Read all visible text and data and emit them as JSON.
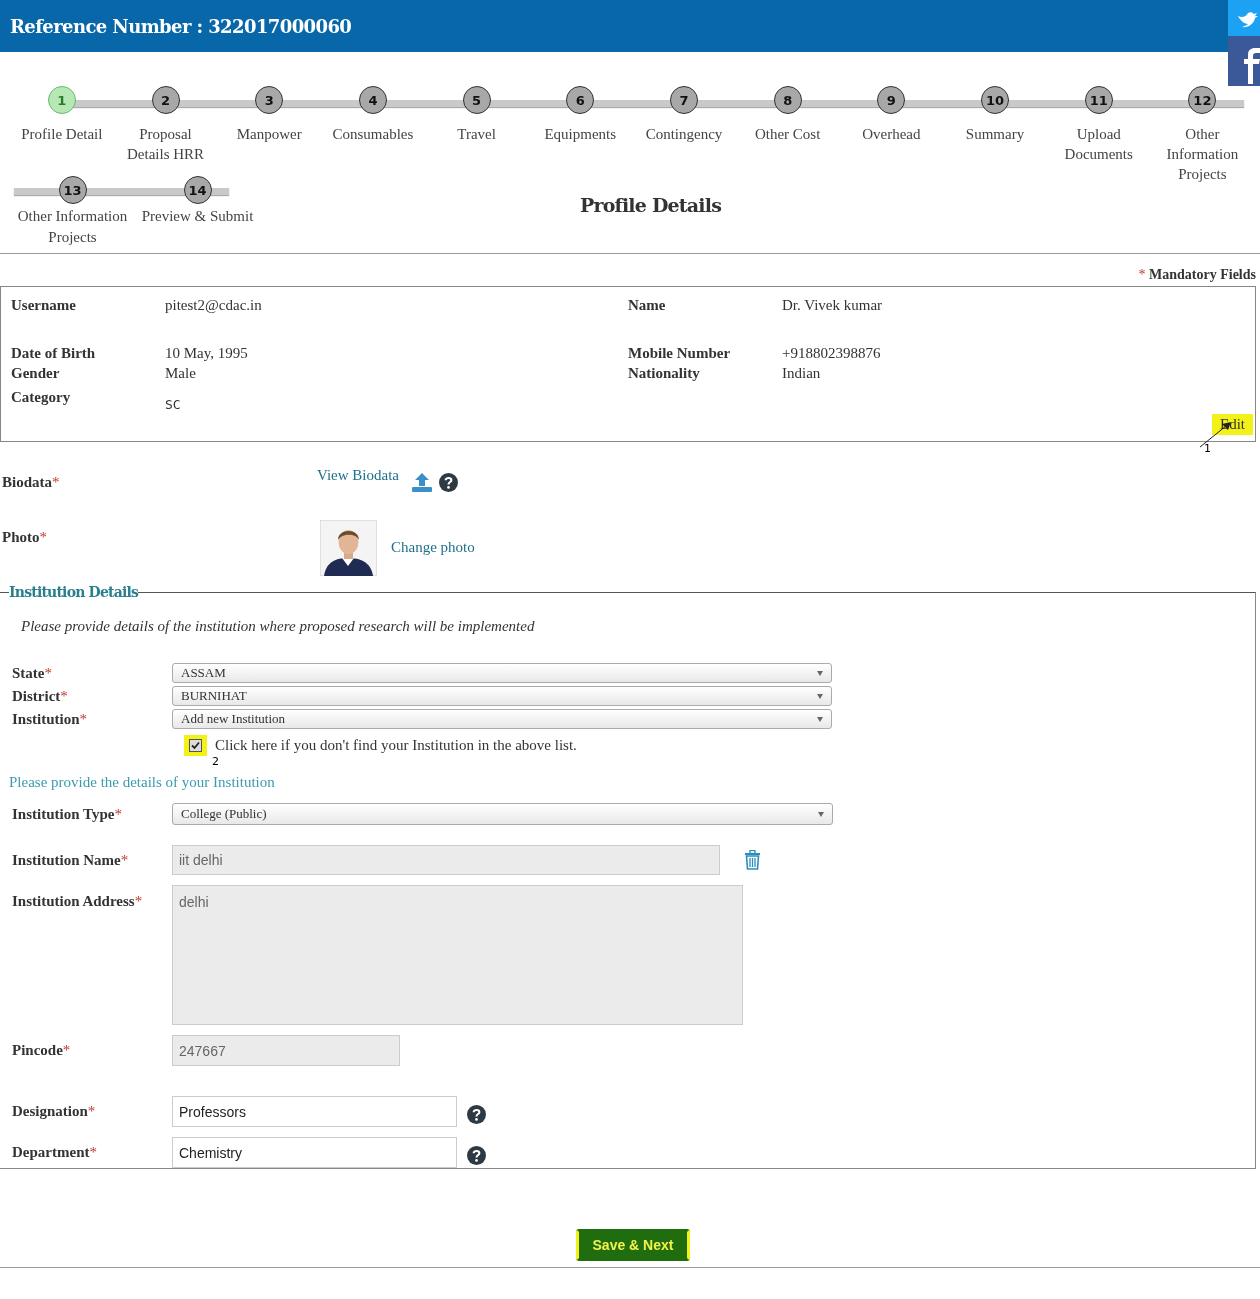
{
  "header": {
    "title": "Reference Number : 322017000060"
  },
  "steps": [
    {
      "number": "1",
      "label": "Profile Detail",
      "selected": true
    },
    {
      "number": "2",
      "label": "Proposal Details HRR",
      "selected": false
    },
    {
      "number": "3",
      "label": "Manpower",
      "selected": false
    },
    {
      "number": "4",
      "label": "Consumables",
      "selected": false
    },
    {
      "number": "5",
      "label": "Travel",
      "selected": false
    },
    {
      "number": "6",
      "label": "Equipments",
      "selected": false
    },
    {
      "number": "7",
      "label": "Contingency",
      "selected": false
    },
    {
      "number": "8",
      "label": "Other Cost",
      "selected": false
    },
    {
      "number": "9",
      "label": "Overhead",
      "selected": false
    },
    {
      "number": "10",
      "label": "Summary",
      "selected": false
    },
    {
      "number": "11",
      "label": "Upload Documents",
      "selected": false
    },
    {
      "number": "12",
      "label": "Other Information Projects",
      "selected": false
    },
    {
      "number": "13",
      "label": "Other  Information Projects",
      "selected": false
    },
    {
      "number": "14",
      "label": "Preview & Submit",
      "selected": false
    }
  ],
  "page_title": "Profile Details",
  "mandatory_note": {
    "mark": "*",
    "text": "Mandatory Fields"
  },
  "profile": {
    "fields": [
      {
        "label": "Username",
        "value": "pitest2@cdac.in"
      },
      {
        "label": "Name",
        "value": "Dr. Vivek  kumar"
      },
      {
        "label": "Date of Birth",
        "value": "10 May, 1995"
      },
      {
        "label": "Mobile Number",
        "value": "+918802398876"
      },
      {
        "label": "Gender",
        "value": "Male"
      },
      {
        "label": "Nationality",
        "value": "Indian"
      },
      {
        "label": "Category",
        "value": "SC"
      }
    ],
    "edit": {
      "label": "Edit",
      "annotation": "1"
    }
  },
  "biodata": {
    "label": "Biodata",
    "link": "View Biodata"
  },
  "photo": {
    "label": "Photo",
    "link": "Change photo"
  },
  "institution": {
    "legend": "Institution Details",
    "intro": "Please provide details of the institution where proposed research will be implemented",
    "selects": [
      {
        "label": "State",
        "value": "ASSAM"
      },
      {
        "label": "District",
        "value": "BURNIHAT"
      },
      {
        "label": "Institution",
        "value": "Add new Institution"
      }
    ],
    "not_found": {
      "label": "Click here if you don't find your Institution in the above list.",
      "checked": true,
      "annotation": "2"
    },
    "details_heading": "Please provide the details of your Institution",
    "type": {
      "label": "Institution Type",
      "value": "College (Public)"
    },
    "name": {
      "label": "Institution Name",
      "value": "iit delhi"
    },
    "address": {
      "label": "Institution Address",
      "value": "delhi"
    },
    "pincode": {
      "label": "Pincode",
      "value": "247667"
    },
    "designation": {
      "label": "Designation",
      "value": "Professors"
    },
    "department": {
      "label": "Department",
      "value": "Chemistry"
    }
  },
  "save_button": "Save & Next"
}
